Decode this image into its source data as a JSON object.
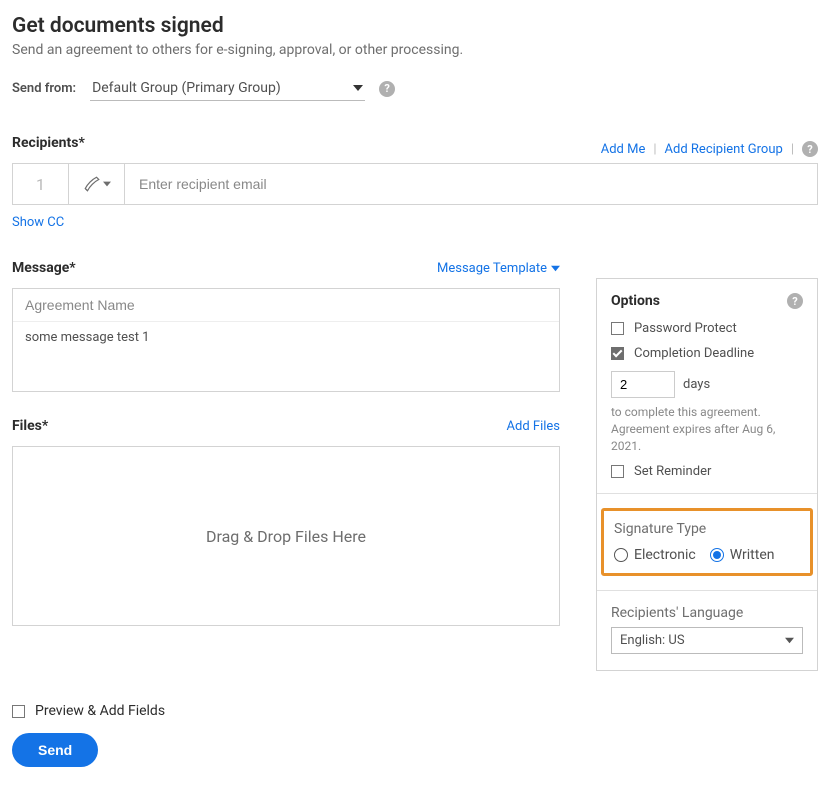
{
  "header": {
    "title": "Get documents signed",
    "subtitle": "Send an agreement to others for e-signing, approval, or other processing."
  },
  "send_from": {
    "label": "Send from:",
    "value": "Default Group (Primary Group)"
  },
  "recipients": {
    "label": "Recipients*",
    "add_me": "Add Me",
    "add_group": "Add Recipient Group",
    "number": "1",
    "email_placeholder": "Enter recipient email",
    "show_cc": "Show CC"
  },
  "message": {
    "label": "Message*",
    "template_link": "Message Template",
    "name_placeholder": "Agreement Name",
    "body": "some message test 1"
  },
  "files": {
    "label": "Files*",
    "add_files": "Add Files",
    "dropzone": "Drag & Drop Files Here"
  },
  "options": {
    "heading": "Options",
    "password_protect": "Password Protect",
    "completion_deadline": "Completion Deadline",
    "days_value": "2",
    "days_label": "days",
    "detail_line1": "to complete this agreement.",
    "detail_line2": "Agreement expires after Aug 6, 2021.",
    "set_reminder": "Set Reminder",
    "signature_type": {
      "heading": "Signature Type",
      "electronic": "Electronic",
      "written": "Written",
      "selected": "written"
    },
    "language": {
      "heading": "Recipients' Language",
      "value": "English: US"
    }
  },
  "footer": {
    "preview_label": "Preview & Add Fields",
    "send": "Send"
  }
}
